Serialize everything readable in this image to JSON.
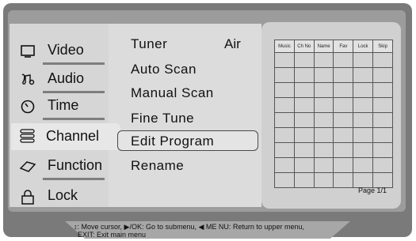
{
  "sidebar": {
    "items": [
      {
        "label": "Video",
        "icon": "monitor-icon"
      },
      {
        "label": "Audio",
        "icon": "music-note-icon"
      },
      {
        "label": "Time",
        "icon": "clock-icon"
      },
      {
        "label": "Channel",
        "icon": "channel-list-icon",
        "active": true
      },
      {
        "label": "Function",
        "icon": "diamond-icon"
      },
      {
        "label": "Lock",
        "icon": "padlock-icon"
      }
    ]
  },
  "submenu": {
    "items": [
      {
        "label": "Tuner",
        "value": "Air"
      },
      {
        "label": "Auto Scan"
      },
      {
        "label": "Manual Scan"
      },
      {
        "label": "Fine Tune"
      },
      {
        "label": "Edit Program",
        "selected": true
      },
      {
        "label": "Rename"
      }
    ]
  },
  "program_table": {
    "columns": [
      "Music",
      "Ch No",
      "Name",
      "Fav",
      "Lock",
      "Skip"
    ],
    "empty_rows": 9,
    "page": "Page 1/1"
  },
  "help": {
    "line1": "↕: Move cursor,  ▶/OK: Go to submenu,  ◀ ME NU: Return to upper menu,",
    "line2": "EXIT: Exit main menu"
  },
  "colors": {
    "frame": "#7a7a7a",
    "panel": "#d6d6d6",
    "highlight": "#e7e7e7"
  }
}
